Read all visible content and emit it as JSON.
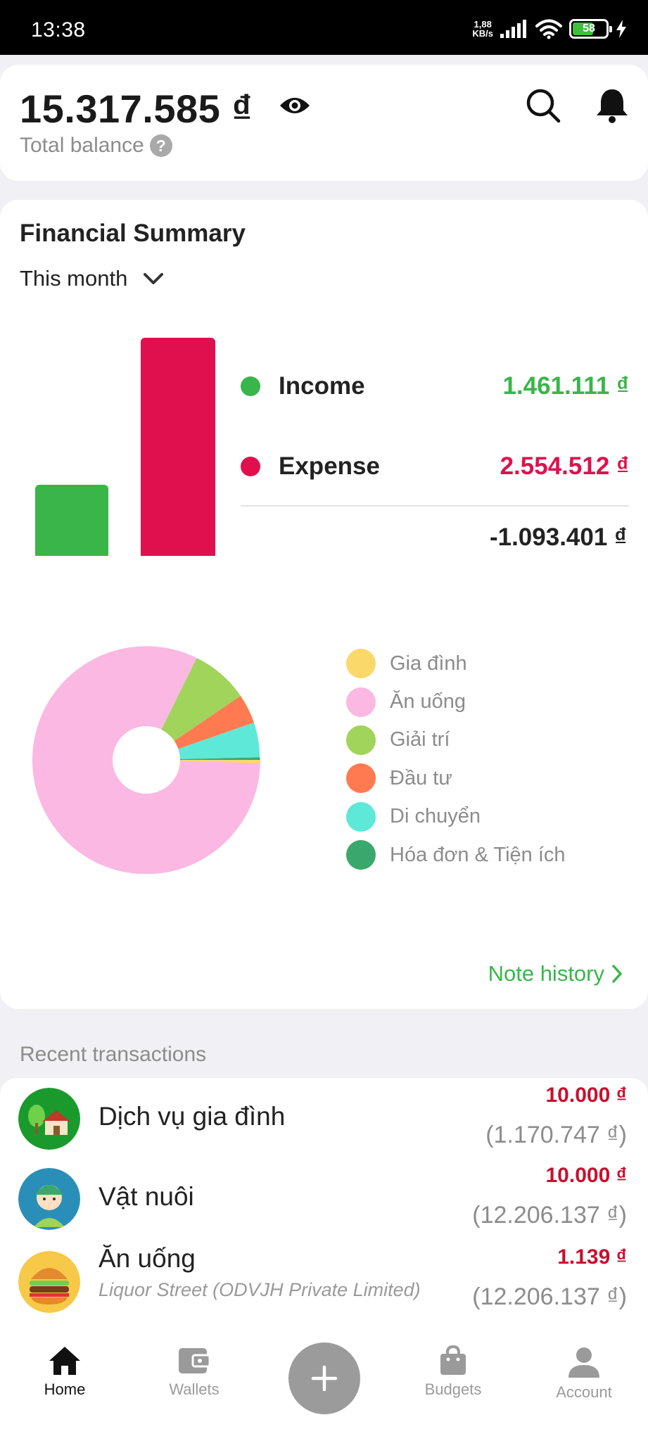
{
  "status_bar": {
    "time": "13:38",
    "net_speed_value": "1,88",
    "net_speed_unit": "KB/s",
    "battery": "58"
  },
  "balance": {
    "amount": "15.317.585 ₫",
    "label": "Total balance",
    "help": "?"
  },
  "summary": {
    "title": "Financial Summary",
    "period": "This month",
    "income": {
      "label": "Income",
      "value": "1.461.111 ₫",
      "color": "#3ab54a",
      "amount": 1461111
    },
    "expense": {
      "label": "Expense",
      "value": "2.554.512 ₫",
      "color": "#e0104e",
      "amount": 2554512
    },
    "net": "-1.093.401 ₫",
    "categories": [
      {
        "label": "Gia đình",
        "color": "#fbd86a"
      },
      {
        "label": "Ăn uống",
        "color": "#fbb8e3"
      },
      {
        "label": "Giải trí",
        "color": "#a0d45a"
      },
      {
        "label": "Đầu tư",
        "color": "#ff7a50"
      },
      {
        "label": "Di chuyển",
        "color": "#5ee8d8"
      },
      {
        "label": "Hóa đơn & Tiện ích",
        "color": "#3aa86c"
      }
    ],
    "note_history": "Note history"
  },
  "recent": {
    "title": "Recent transactions",
    "items": [
      {
        "name": "Dịch vụ gia đình",
        "note": "",
        "amount": "10.000 ₫",
        "balance_after": "(1.170.747 ₫)",
        "icon": "house-icon"
      },
      {
        "name": "Vật nuôi",
        "note": "",
        "amount": "10.000 ₫",
        "balance_after": "(12.206.137 ₫)",
        "icon": "person-icon"
      },
      {
        "name": "Ăn uống",
        "note": "Liquor Street (ODVJH Private Limited)",
        "amount": "1.139 ₫",
        "balance_after": "(12.206.137 ₫)",
        "icon": "burger-icon"
      }
    ]
  },
  "nav": {
    "home": "Home",
    "wallets": "Wallets",
    "budgets": "Budgets",
    "account": "Account"
  }
}
